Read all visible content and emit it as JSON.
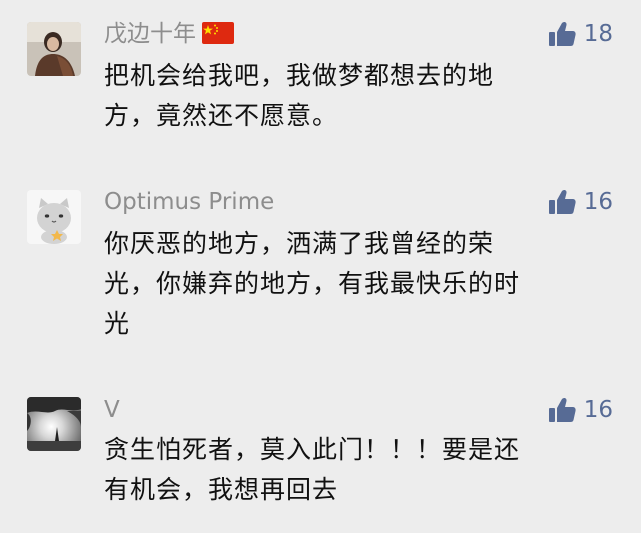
{
  "comments": [
    {
      "author": "戊边十年",
      "likes": "18",
      "lines": [
        "把机会给我吧，我做梦都想去的地",
        "方，竟然还不愿意。"
      ],
      "flag_icon": "china-flag-icon",
      "avatar_icon": "person-avatar-icon"
    },
    {
      "author": "Optimus Prime",
      "likes": "16",
      "lines": [
        "你厌恶的地方，洒满了我曾经的荣",
        "光，你嫌弃的地方，有我最快乐的时",
        "光"
      ],
      "avatar_icon": "cartoon-cat-avatar-icon"
    },
    {
      "author": "V",
      "likes": "16",
      "lines": [
        "贪生怕死者，莫入此门！！！要是还",
        "有机会，我想再回去"
      ],
      "avatar_icon": "tree-sunset-avatar-icon"
    }
  ],
  "colors": {
    "background": "#ededed",
    "author": "#8d8d8d",
    "like": "#576b95",
    "text": "#111111"
  },
  "like_icon": "thumbs-up-icon"
}
